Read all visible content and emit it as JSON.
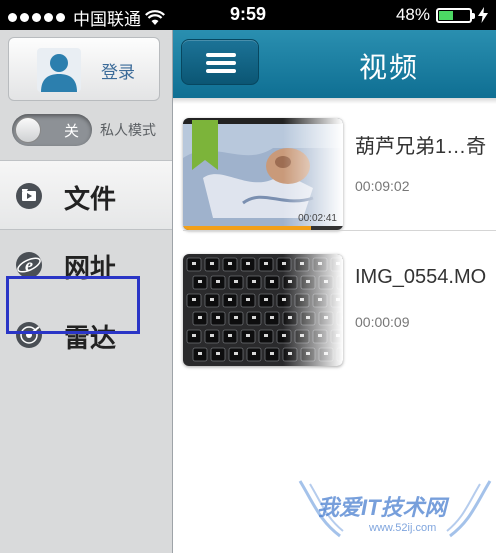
{
  "status_bar": {
    "carrier": "中国联通",
    "time": "9:59",
    "battery": "48%",
    "battery_level": 0.48
  },
  "sidebar": {
    "login_label": "登录",
    "toggle_state": "关",
    "private_mode_label": "私人模式",
    "items": [
      {
        "label": "文件",
        "icon": "file-icon"
      },
      {
        "label": "网址",
        "icon": "browser-e-icon"
      },
      {
        "label": "雷达",
        "icon": "radar-icon"
      }
    ]
  },
  "header": {
    "title": "视频"
  },
  "videos": [
    {
      "title": "葫芦兄弟1…奇",
      "duration": "00:09:02",
      "thumb_time": "00:02:41",
      "progress": 0.8
    },
    {
      "title": "IMG_0554.MO",
      "duration": "00:00:09"
    }
  ],
  "watermark": {
    "text": "我爱IT技术网",
    "url": "www.52ij.com"
  },
  "colors": {
    "header": "#1a7fa3",
    "highlight": "#2a35c6",
    "bookmark": "#7cb43a",
    "progress": "#f2a019"
  }
}
